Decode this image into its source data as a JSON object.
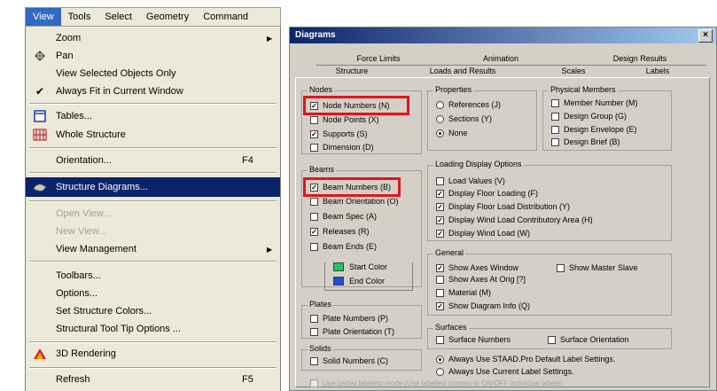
{
  "menubar": {
    "items": [
      "View",
      "Tools",
      "Select",
      "Geometry",
      "Command"
    ],
    "active": "View"
  },
  "menu": {
    "items": [
      {
        "label": "Zoom",
        "icon": "",
        "submenu": true,
        "shortcut": "",
        "checked": false,
        "disabled": false,
        "highlighted": false
      },
      {
        "label": "Pan",
        "icon": "pan-icon",
        "submenu": false,
        "shortcut": "",
        "checked": false,
        "disabled": false,
        "highlighted": false
      },
      {
        "label": "View Selected Objects Only",
        "icon": "",
        "submenu": false,
        "shortcut": "",
        "checked": false,
        "disabled": false,
        "highlighted": false
      },
      {
        "label": "Always Fit in Current Window",
        "icon": "check-icon",
        "submenu": false,
        "shortcut": "",
        "checked": true,
        "disabled": false,
        "highlighted": false
      },
      {
        "label": "Tables...",
        "icon": "table-icon",
        "submenu": false,
        "shortcut": "",
        "checked": false,
        "disabled": false,
        "highlighted": false
      },
      {
        "label": "Whole Structure",
        "icon": "whole-structure-icon",
        "submenu": false,
        "shortcut": "",
        "checked": false,
        "disabled": false,
        "highlighted": false
      },
      {
        "label": "Orientation...",
        "icon": "",
        "submenu": false,
        "shortcut": "F4",
        "checked": false,
        "disabled": false,
        "highlighted": false
      },
      {
        "label": "Structure Diagrams...",
        "icon": "structure-diagrams-icon",
        "submenu": false,
        "shortcut": "",
        "checked": false,
        "disabled": false,
        "highlighted": true
      },
      {
        "label": "Open View...",
        "icon": "",
        "submenu": false,
        "shortcut": "",
        "checked": false,
        "disabled": true,
        "highlighted": false
      },
      {
        "label": "New View...",
        "icon": "",
        "submenu": false,
        "shortcut": "",
        "checked": false,
        "disabled": true,
        "highlighted": false
      },
      {
        "label": "View Management",
        "icon": "",
        "submenu": true,
        "shortcut": "",
        "checked": false,
        "disabled": false,
        "highlighted": false
      },
      {
        "label": "Toolbars...",
        "icon": "",
        "submenu": false,
        "shortcut": "",
        "checked": false,
        "disabled": false,
        "highlighted": false
      },
      {
        "label": "Options...",
        "icon": "",
        "submenu": false,
        "shortcut": "",
        "checked": false,
        "disabled": false,
        "highlighted": false
      },
      {
        "label": "Set Structure Colors...",
        "icon": "",
        "submenu": false,
        "shortcut": "",
        "checked": false,
        "disabled": false,
        "highlighted": false
      },
      {
        "label": "Structural Tool Tip Options ...",
        "icon": "",
        "submenu": false,
        "shortcut": "",
        "checked": false,
        "disabled": false,
        "highlighted": false
      },
      {
        "label": "3D Rendering",
        "icon": "3d-rendering-icon",
        "submenu": false,
        "shortcut": "",
        "checked": false,
        "disabled": false,
        "highlighted": false
      },
      {
        "label": "Refresh",
        "icon": "",
        "submenu": false,
        "shortcut": "F5",
        "checked": false,
        "disabled": false,
        "highlighted": false
      }
    ]
  },
  "dialog": {
    "title": "Diagrams",
    "close_label": "×",
    "tabs_back": [
      "Force Limits",
      "Animation",
      "Design Results"
    ],
    "tabs_front": [
      "Structure",
      "Loads and Results",
      "Scales",
      "Labels"
    ],
    "active_tab": "Labels",
    "groups": {
      "nodes": {
        "title": "Nodes",
        "options": [
          {
            "label": "Node Numbers (N)",
            "checked": true
          },
          {
            "label": "Node Points (X)",
            "checked": false
          },
          {
            "label": "Supports (S)",
            "checked": true
          },
          {
            "label": "Dimension (D)",
            "checked": false
          }
        ]
      },
      "beams": {
        "title": "Beams",
        "options": [
          {
            "label": "Beam Numbers (B)",
            "checked": true
          },
          {
            "label": "Beam Orientation (O)",
            "checked": false
          },
          {
            "label": "Beam Spec (A)",
            "checked": false
          },
          {
            "label": "Releases (R)",
            "checked": true
          },
          {
            "label": "Beam Ends (E)",
            "checked": false
          }
        ],
        "colors": [
          {
            "label": "Start Color",
            "color": "#22c55e"
          },
          {
            "label": "End Color",
            "color": "#1d4ed8"
          }
        ]
      },
      "plates": {
        "title": "Plates",
        "options": [
          {
            "label": "Plate Numbers (P)",
            "checked": false
          },
          {
            "label": "Plate Orientation (T)",
            "checked": false
          }
        ]
      },
      "solids": {
        "title": "Solids",
        "options": [
          {
            "label": "Solid Numbers (C)",
            "checked": false
          }
        ]
      },
      "properties": {
        "title": "Properties",
        "options": [
          {
            "label": "References (J)",
            "selected": false
          },
          {
            "label": "Sections (Y)",
            "selected": false
          },
          {
            "label": "None",
            "selected": true
          }
        ]
      },
      "physical_members": {
        "title": "Physical Members",
        "options": [
          {
            "label": "Member Number (M)",
            "checked": false
          },
          {
            "label": "Design Group (G)",
            "checked": false
          },
          {
            "label": "Design Envelope (E)",
            "checked": false
          },
          {
            "label": "Design Brief (B)",
            "checked": false
          }
        ]
      },
      "loading_display": {
        "title": "Loading Display Options",
        "options": [
          {
            "label": "Load Values (V)",
            "checked": false
          },
          {
            "label": "Display Floor Loading (F)",
            "checked": true
          },
          {
            "label": "Display Floor Load Distribution (Y)",
            "checked": true
          },
          {
            "label": "Display Wind Load Contributory Area (H)",
            "checked": true
          },
          {
            "label": "Display Wind Load (W)",
            "checked": true
          }
        ]
      },
      "general": {
        "title": "General",
        "options": [
          {
            "label": "Show Axes Window",
            "checked": true
          },
          {
            "label": "Show Master Slave",
            "checked": false
          },
          {
            "label": "Show Axes At Orig [?]",
            "checked": false
          },
          {
            "label": "Material (M)",
            "checked": false
          },
          {
            "label": "Show Diagram Info (Q)",
            "checked": true
          }
        ]
      },
      "surfaces": {
        "title": "Surfaces",
        "options": [
          {
            "label": "Surface Numbers",
            "checked": false
          },
          {
            "label": "Surface Orientation",
            "checked": false
          }
        ]
      },
      "label_settings": {
        "options": [
          {
            "label": "Always Use STAAD.Pro Default Label Settings.",
            "selected": true
          },
          {
            "label": "Always Use Current Label Settings.",
            "selected": false
          }
        ]
      },
      "partial_footer": "Use partial labeling mode (Use labelled corners to ON/OFF individual labels)"
    }
  }
}
